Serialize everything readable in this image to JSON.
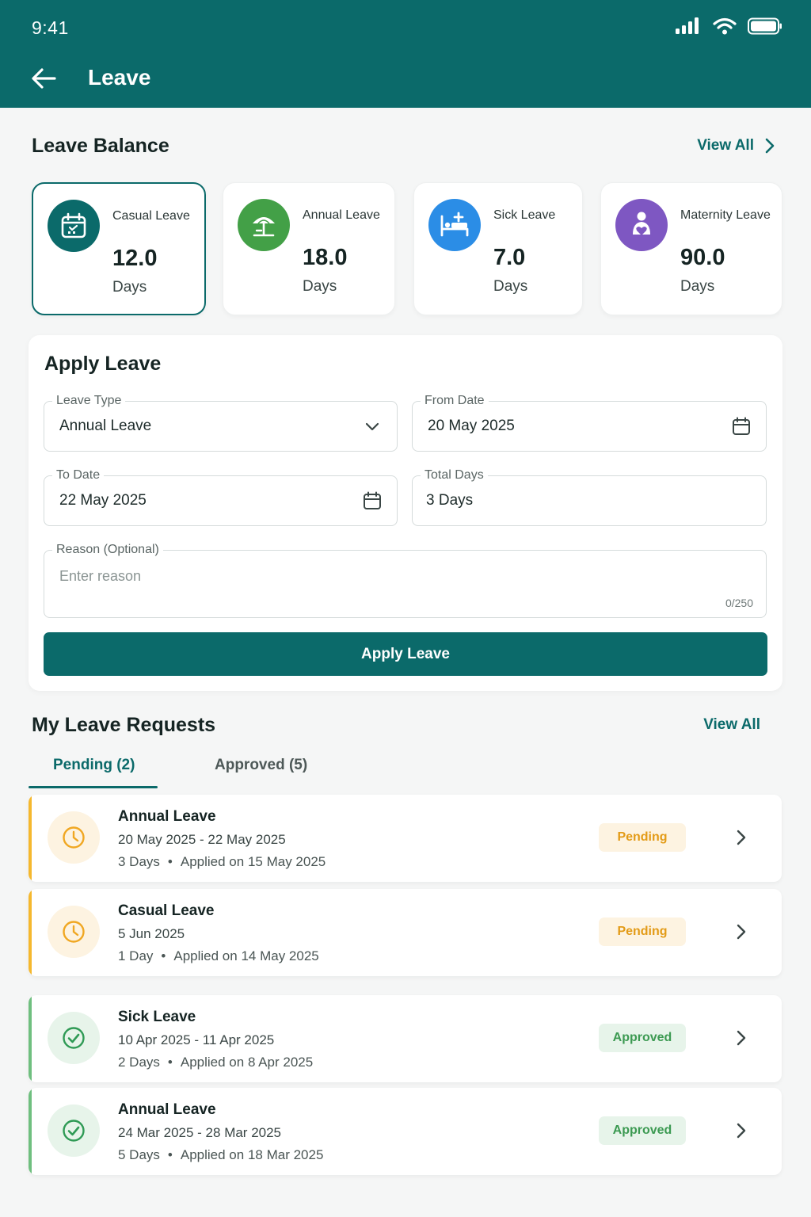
{
  "status_bar": {
    "time": "9:41"
  },
  "header": {
    "title": "Leave"
  },
  "balance": {
    "title": "Leave Balance",
    "view_all": "View All",
    "cards": [
      {
        "label": "Casual Leave",
        "value": "12.0",
        "unit": "Days",
        "icon": "calendar-icon",
        "color": "#0b6a6a"
      },
      {
        "label": "Annual Leave",
        "value": "18.0",
        "unit": "Days",
        "icon": "beach-umbrella-icon",
        "color": "#43a047"
      },
      {
        "label": "Sick Leave",
        "value": "7.0",
        "unit": "Days",
        "icon": "hospital-bed-icon",
        "color": "#2b8de6"
      },
      {
        "label": "Maternity Leave",
        "value": "90.0",
        "unit": "Days",
        "icon": "mother-baby-icon",
        "color": "#7e57c2"
      }
    ]
  },
  "apply_form": {
    "title": "Apply Leave",
    "leave_type": {
      "label": "Leave Type",
      "value": "Annual Leave"
    },
    "from_date": {
      "label": "From Date",
      "value": "20 May 2025"
    },
    "to_date": {
      "label": "To Date",
      "value": "22 May 2025"
    },
    "total_days": {
      "label": "Total Days",
      "value": "3 Days"
    },
    "reason": {
      "label": "Reason (Optional)",
      "placeholder": "Enter reason",
      "counter": "0/250"
    },
    "submit_label": "Apply Leave"
  },
  "requests": {
    "title": "My Leave Requests",
    "view_all": "View All",
    "tabs": [
      {
        "label": "Pending (2)",
        "active": true
      },
      {
        "label": "Approved (5)",
        "active": false
      }
    ],
    "items": [
      {
        "title": "Annual Leave",
        "dates": "20 May 2025 - 22 May 2025",
        "days": "3 Days",
        "applied": "Applied on 15 May 2025",
        "status": "Pending"
      },
      {
        "title": "Casual Leave",
        "dates": "5 Jun 2025",
        "days": "1 Day",
        "applied": "Applied on 14 May 2025",
        "status": "Pending"
      },
      {
        "title": "Sick Leave",
        "dates": "10 Apr 2025 - 11 Apr 2025",
        "days": "2 Days",
        "applied": "Applied on 8 Apr 2025",
        "status": "Approved"
      },
      {
        "title": "Annual Leave",
        "dates": "24 Mar 2025 - 28 Mar 2025",
        "days": "5 Days",
        "applied": "Applied on 18 Mar 2025",
        "status": "Approved"
      }
    ],
    "meta_separator": "•"
  },
  "colors": {
    "primary": "#0b6a6a",
    "pending": "#f5b82e",
    "approved": "#3c9a52"
  }
}
